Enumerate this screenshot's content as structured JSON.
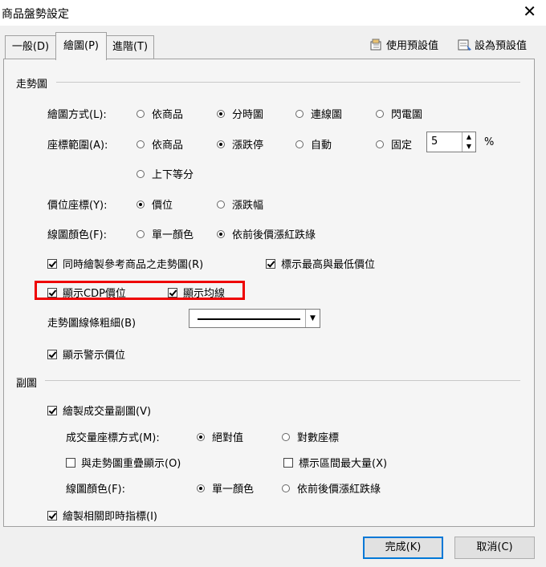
{
  "window": {
    "title": "商品盤勢設定",
    "close_glyph": "✕"
  },
  "tabs": [
    {
      "label": "一般(D)"
    },
    {
      "label": "繪圖(P)",
      "active": true
    },
    {
      "label": "進階(T)"
    }
  ],
  "toolbar": {
    "use_default": "使用預設值",
    "set_default": "設為預設值"
  },
  "trend": {
    "title": "走勢圖",
    "draw_method": {
      "label": "繪圖方式(L):",
      "options": [
        "依商品",
        "分時圖",
        "連線圖",
        "閃電圖"
      ],
      "selected": "分時圖"
    },
    "coord_range": {
      "label": "座標範圍(A):",
      "options": [
        "依商品",
        "漲跌停",
        "自動",
        "固定",
        "上下等分"
      ],
      "selected": "漲跌停",
      "fixed_value": "5",
      "unit": "%"
    },
    "price_coord": {
      "label": "價位座標(Y):",
      "options": [
        "價位",
        "漲跌幅"
      ],
      "selected": "價位"
    },
    "line_color": {
      "label": "線圖顏色(F):",
      "options": [
        "單一顏色",
        "依前後價漲紅跌綠"
      ],
      "selected": "依前後價漲紅跌綠"
    },
    "chk_ref": {
      "label": "同時繪製參考商品之走勢圖(R)",
      "checked": true
    },
    "chk_hilo": {
      "label": "標示最高與最低價位",
      "checked": true
    },
    "chk_cdp": {
      "label": "顯示CDP價位",
      "checked": true
    },
    "chk_avg": {
      "label": "顯示均線",
      "checked": true
    },
    "line_thickness": {
      "label": "走勢圖線條粗細(B)"
    },
    "chk_warn": {
      "label": "顯示警示價位",
      "checked": true
    }
  },
  "sub": {
    "title": "副圖",
    "chk_volume": {
      "label": "繪製成交量副圖(V)",
      "checked": true
    },
    "vol_coord": {
      "label": "成交量座標方式(M):",
      "options": [
        "絕對值",
        "對數座標"
      ],
      "selected": "絕對值"
    },
    "chk_overlay": {
      "label": "與走勢圖重疊顯示(O)",
      "checked": false
    },
    "chk_maxvol": {
      "label": "標示區間最大量(X)",
      "checked": false
    },
    "line_color": {
      "label": "線圖顏色(F):",
      "options": [
        "單一顏色",
        "依前後價漲紅跌綠"
      ],
      "selected": "單一顏色"
    },
    "chk_indicator": {
      "label": "繪製相關即時指標(I)",
      "checked": true
    }
  },
  "buttons": {
    "ok": "完成(K)",
    "cancel": "取消(C)"
  },
  "colors": {
    "highlight": "#e00000",
    "default_button_border": "#0078d7"
  }
}
